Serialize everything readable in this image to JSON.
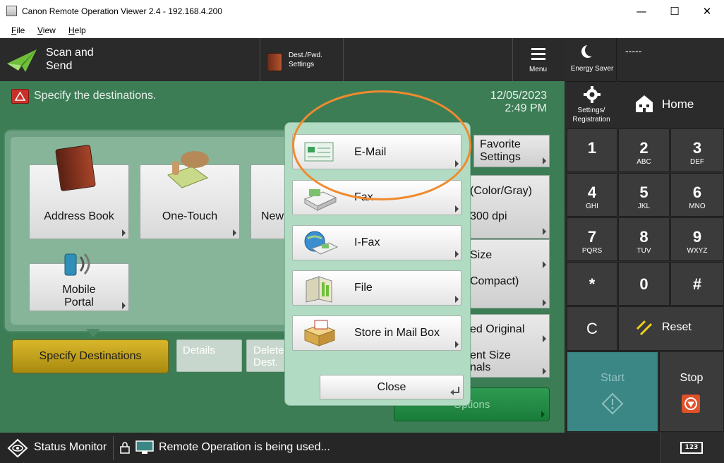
{
  "window": {
    "title": "Canon Remote Operation Viewer 2.4 - 192.168.4.200",
    "minimize": "—",
    "maximize": "☐",
    "close": "✕"
  },
  "menubar": [
    {
      "label": "File",
      "accel": "F",
      "rest": "ile"
    },
    {
      "label": "View",
      "accel": "V",
      "rest": "iew"
    },
    {
      "label": "Help",
      "accel": "H",
      "rest": "elp"
    }
  ],
  "topbar": {
    "app_title_line1": "Scan and",
    "app_title_line2": "Send",
    "dest_fwd_line1": "Dest./Fwd.",
    "dest_fwd_line2": "Settings",
    "menu_label": "Menu"
  },
  "main": {
    "instruction": "Specify the destinations.",
    "date": "12/05/2023",
    "time": "2:49 PM",
    "tiles": {
      "address_book": "Address Book",
      "one_touch": "One-Touch",
      "new_partial": "New",
      "mobile_portal_line1": "Mobile",
      "mobile_portal_line2": "Portal"
    },
    "specify_destinations": "Specify Destinations",
    "details": "Details",
    "delete_dest_line1": "Delete",
    "delete_dest_line2": "Dest.",
    "background_settings": {
      "favorite_line1": "Favorite",
      "favorite_line2": "Settings",
      "color": "(Color/Gray)",
      "resolution": "300 dpi",
      "size": "Size",
      "compact": "Compact)",
      "original": "ed Original",
      "different_size_line1": "ent Size",
      "different_size_line2": "nals",
      "options": "Options"
    }
  },
  "popup": {
    "items": [
      {
        "label": "E-Mail",
        "icon": "email-icon"
      },
      {
        "label": "Fax",
        "icon": "fax-icon"
      },
      {
        "label": "I-Fax",
        "icon": "ifax-icon"
      },
      {
        "label": "File",
        "icon": "file-icon"
      },
      {
        "label": "Store in Mail Box",
        "icon": "mailbox-icon"
      }
    ],
    "close": "Close"
  },
  "right_panel": {
    "energy_saver": "Energy Saver",
    "status_dashes": "-----",
    "settings_line1": "Settings/",
    "settings_line2": "Registration",
    "home": "Home",
    "keys": [
      {
        "num": "1",
        "sub": ""
      },
      {
        "num": "2",
        "sub": "ABC"
      },
      {
        "num": "3",
        "sub": "DEF"
      },
      {
        "num": "4",
        "sub": "GHI"
      },
      {
        "num": "5",
        "sub": "JKL"
      },
      {
        "num": "6",
        "sub": "MNO"
      },
      {
        "num": "7",
        "sub": "PQRS"
      },
      {
        "num": "8",
        "sub": "TUV"
      },
      {
        "num": "9",
        "sub": "WXYZ"
      },
      {
        "num": "*",
        "sub": ""
      },
      {
        "num": "0",
        "sub": ""
      },
      {
        "num": "#",
        "sub": ""
      }
    ],
    "clear": "C",
    "reset": "Reset",
    "start": "Start",
    "stop": "Stop"
  },
  "statusbar": {
    "status_monitor": "Status Monitor",
    "remote_message": "Remote Operation is being used...",
    "keypad_label": "123"
  },
  "colors": {
    "green_bg": "#3c7d56",
    "accent_orange": "#f08a2e",
    "dest_button": "#c4a21c"
  }
}
